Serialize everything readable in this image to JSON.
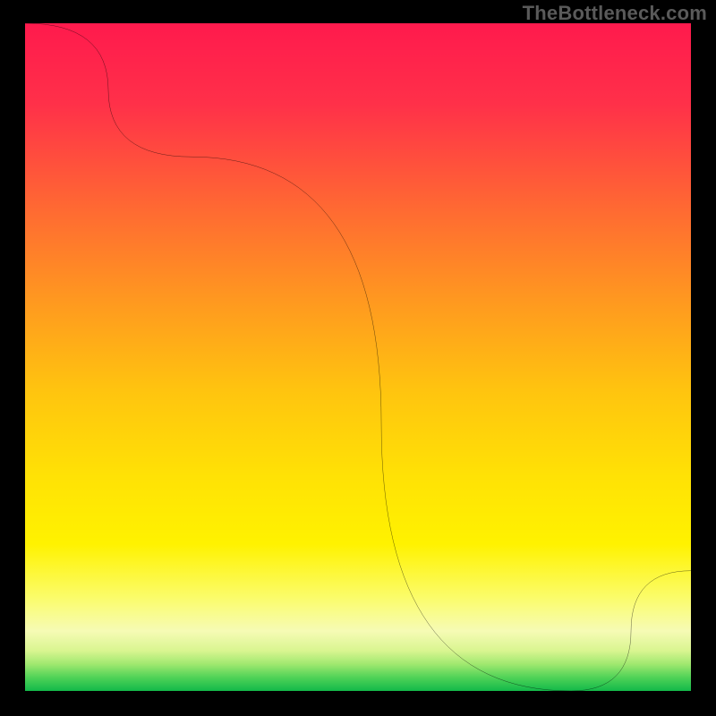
{
  "watermark": "TheBottleneck.com",
  "marker_label": "",
  "colors": {
    "frame": "#000000",
    "watermark": "#5a5a5a",
    "line": "#000000",
    "marker_text": "#b0241e"
  },
  "chart_data": {
    "type": "line",
    "title": "",
    "xlabel": "",
    "ylabel": "",
    "x": [
      0,
      25,
      82,
      100
    ],
    "y": [
      100,
      80,
      0,
      18
    ],
    "xlim": [
      0,
      100
    ],
    "ylim": [
      0,
      100
    ],
    "marker": {
      "x": 82,
      "y": 0
    },
    "annotations": [],
    "notes": "Smooth black curve over vertical rainbow gradient (red→orange→yellow→green). Minimum at x≈82 then rises toward right edge. No visible axes, ticks, or labels; only a watermark at top-right and a small dark-red marker text near the curve minimum."
  },
  "gradient_stops": [
    {
      "offset": 0,
      "color": "#ff1a4d"
    },
    {
      "offset": 12,
      "color": "#ff3049"
    },
    {
      "offset": 28,
      "color": "#ff6a32"
    },
    {
      "offset": 42,
      "color": "#ff9a1f"
    },
    {
      "offset": 55,
      "color": "#ffc40f"
    },
    {
      "offset": 68,
      "color": "#ffe205"
    },
    {
      "offset": 78,
      "color": "#fff200"
    },
    {
      "offset": 86,
      "color": "#fbfc6a"
    },
    {
      "offset": 91,
      "color": "#f6fbb5"
    },
    {
      "offset": 94,
      "color": "#d9f590"
    },
    {
      "offset": 96,
      "color": "#9fe86f"
    },
    {
      "offset": 98,
      "color": "#4fd257"
    },
    {
      "offset": 100,
      "color": "#13b94a"
    }
  ]
}
